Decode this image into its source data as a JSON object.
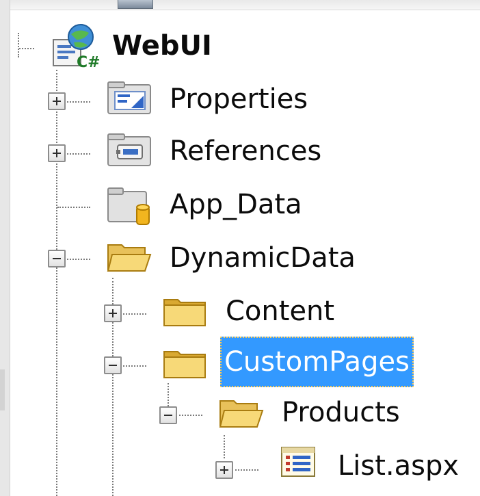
{
  "solution_explorer": {
    "root": {
      "label": "WebUI",
      "icon": "csharp-web-project-icon"
    },
    "nodes": [
      {
        "label": "Properties",
        "icon": "properties-icon",
        "expander": "plus"
      },
      {
        "label": "References",
        "icon": "references-icon",
        "expander": "plus"
      },
      {
        "label": "App_Data",
        "icon": "app-data-folder-icon",
        "expander": "none"
      },
      {
        "label": "DynamicData",
        "icon": "open-folder-icon",
        "expander": "minus"
      },
      {
        "label": "Content",
        "icon": "folder-icon",
        "expander": "plus"
      },
      {
        "label": "CustomPages",
        "icon": "folder-icon",
        "expander": "minus",
        "selected": true
      },
      {
        "label": "Products",
        "icon": "open-folder-icon",
        "expander": "minus"
      },
      {
        "label": "List.aspx",
        "icon": "aspx-page-icon",
        "expander": "plus"
      }
    ],
    "colors": {
      "selection_background": "#3399ff",
      "selection_text": "#ffffff",
      "text": "#0b0b0b"
    }
  }
}
